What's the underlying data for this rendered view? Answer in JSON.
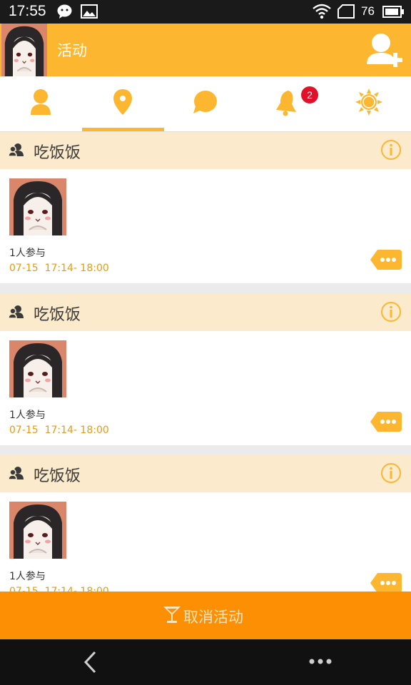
{
  "status_bar": {
    "time": "17:55",
    "battery": "76",
    "icons": [
      "chat-notification-icon",
      "image-notification-icon",
      "wifi-icon",
      "sim-icon",
      "battery-icon"
    ]
  },
  "app_bar": {
    "title": "活动",
    "avatar": "avatar",
    "action_icon": "add-user-icon"
  },
  "tabs": {
    "items": [
      {
        "icon": "person-icon",
        "selected": false
      },
      {
        "icon": "location-pin-icon",
        "selected": true
      },
      {
        "icon": "chat-bubble-icon",
        "selected": false
      },
      {
        "icon": "bell-icon",
        "selected": false,
        "badge": "2"
      },
      {
        "icon": "sun-icon",
        "selected": false
      }
    ]
  },
  "activities": [
    {
      "title": "吃饭饭",
      "participants": "1人参与",
      "time": "07-15  17:14- 18:00"
    },
    {
      "title": "吃饭饭",
      "participants": "1人参与",
      "time": "07-15  17:14- 18:00"
    },
    {
      "title": "吃饭饭",
      "participants": "1人参与",
      "time": "07-15  17:14- 18:00"
    }
  ],
  "bottom_action": {
    "label": "取消活动",
    "icon": "cocktail-icon"
  },
  "colors": {
    "accent": "#fdb62f",
    "action_bar": "#fc8f03",
    "time_text": "#e89a11",
    "badge": "#e0122a",
    "header_bg": "#fbeacb"
  }
}
